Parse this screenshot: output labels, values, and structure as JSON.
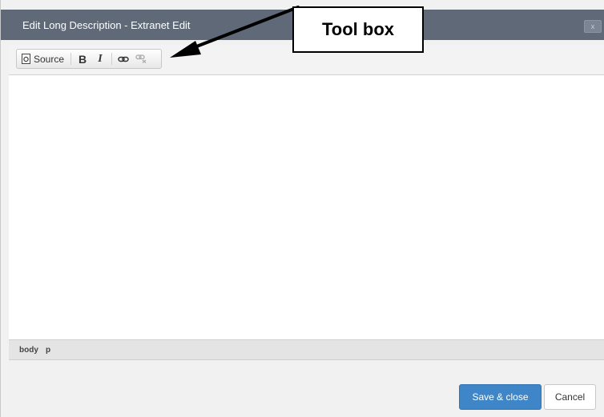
{
  "dialog": {
    "title": "Edit Long Description - Extranet Edit",
    "close_label": "x"
  },
  "toolbar": {
    "source_label": "Source",
    "bold_label": "B",
    "italic_label": "I"
  },
  "pathbar": {
    "items": [
      "body",
      "p"
    ]
  },
  "footer": {
    "save_label": "Save & close",
    "cancel_label": "Cancel"
  },
  "annotation": {
    "callout_text": "Tool box"
  },
  "colors": {
    "titlebar": "#5f6978",
    "primary_button": "#3f86c8"
  }
}
